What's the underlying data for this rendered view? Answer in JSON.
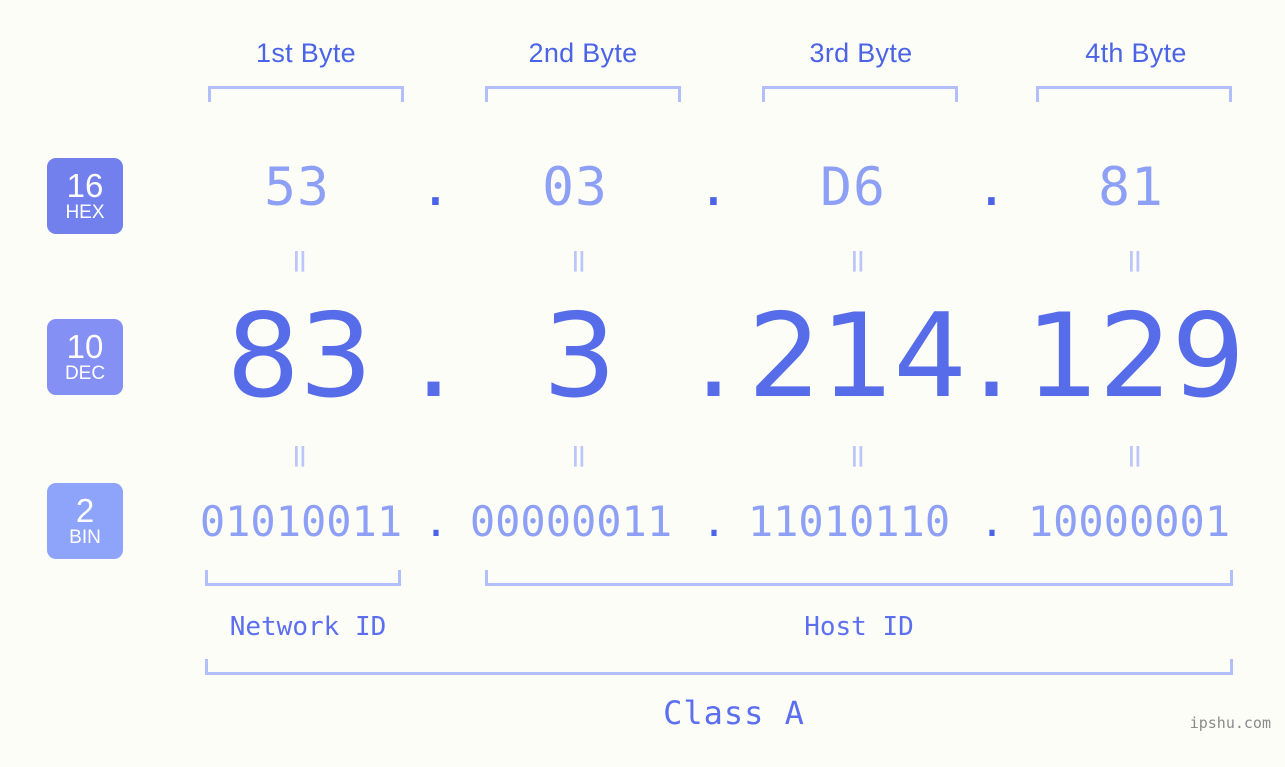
{
  "page": {
    "background_color": "#fdfdf7",
    "accent_color": "#5b6ff0",
    "bracket_color": "#b3bffa",
    "watermark": "ipshu.com"
  },
  "byte_headers": [
    {
      "label": "1st Byte"
    },
    {
      "label": "2nd Byte"
    },
    {
      "label": "3rd Byte"
    },
    {
      "label": "4th Byte"
    }
  ],
  "radix_badges": [
    {
      "number": "16",
      "name": "HEX",
      "color": "#7180ec"
    },
    {
      "number": "10",
      "name": "DEC",
      "color": "#8490f4"
    },
    {
      "number": "2",
      "name": "BIN",
      "color": "#8da4fa"
    }
  ],
  "separator": ".",
  "equality_mark": "=",
  "rows": {
    "hex": {
      "radix": "16",
      "radix_name": "HEX",
      "values": [
        "53",
        "03",
        "D6",
        "81"
      ],
      "joined": "53.03.D6.81"
    },
    "dec": {
      "radix": "10",
      "radix_name": "DEC",
      "values": [
        "83",
        "3",
        "214",
        "129"
      ],
      "joined": "83.3.214.129"
    },
    "bin": {
      "radix": "2",
      "radix_name": "BIN",
      "values": [
        "01010011",
        "00000011",
        "11010110",
        "10000001"
      ],
      "joined": "01010011.00000011.11010110.10000001"
    }
  },
  "segments": {
    "network_id": "Network ID",
    "host_id": "Host ID",
    "class": "Class A"
  }
}
